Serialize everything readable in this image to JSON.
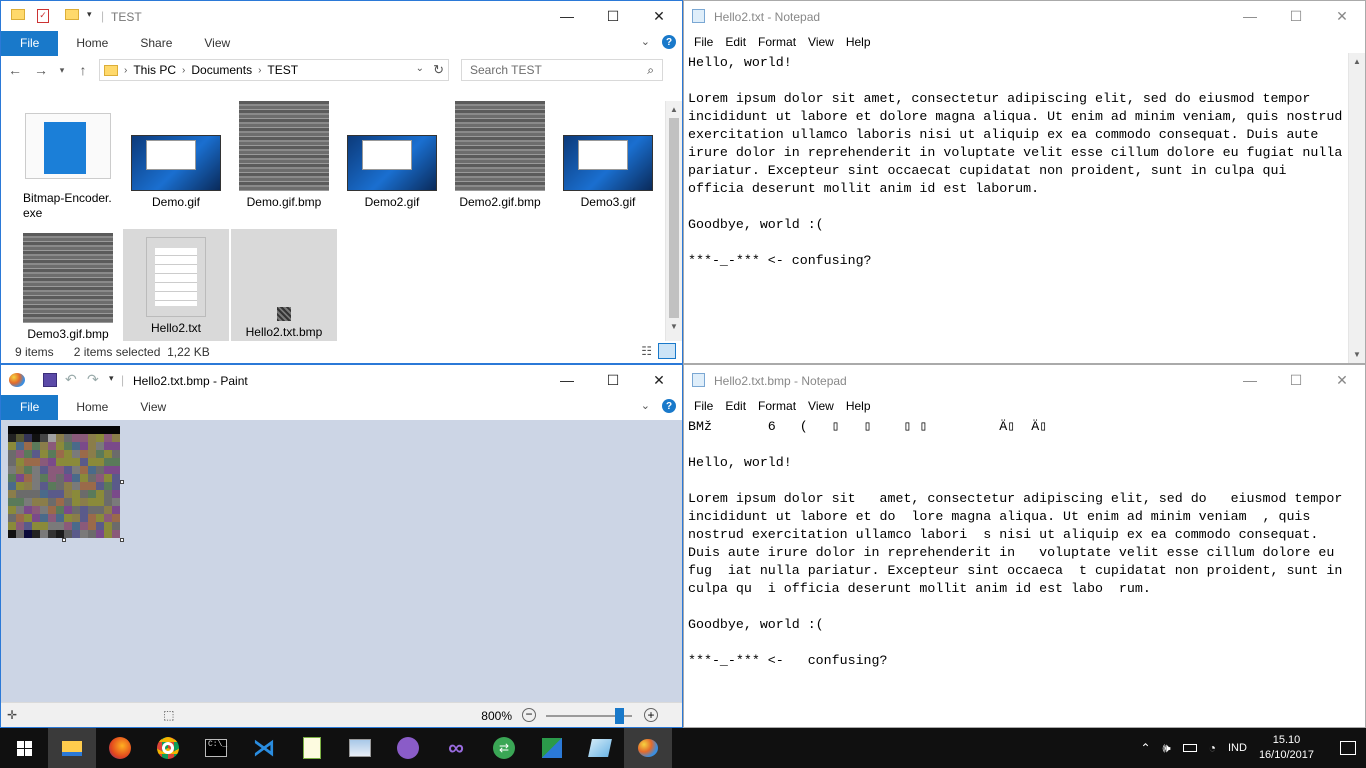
{
  "explorer": {
    "title": "TEST",
    "tabs": [
      "File",
      "Home",
      "Share",
      "View"
    ],
    "path": [
      "This PC",
      "Documents",
      "TEST"
    ],
    "search_placeholder": "Search TEST",
    "items": [
      {
        "name": "Bitmap-Encoder.\nexe",
        "kind": "exe",
        "selected": false
      },
      {
        "name": "Demo.gif",
        "kind": "desktop",
        "selected": false
      },
      {
        "name": "Demo.gif.bmp",
        "kind": "wood",
        "selected": false
      },
      {
        "name": "Demo2.gif",
        "kind": "desktop",
        "selected": false
      },
      {
        "name": "Demo2.gif.bmp",
        "kind": "wood",
        "selected": false
      },
      {
        "name": "Demo3.gif",
        "kind": "desktop",
        "selected": false
      },
      {
        "name": "Demo3.gif.bmp",
        "kind": "wood",
        "selected": false
      },
      {
        "name": "Hello2.txt",
        "kind": "txt",
        "selected": true
      },
      {
        "name": "Hello2.txt.bmp",
        "kind": "bmp",
        "selected": true
      }
    ],
    "status": {
      "count": "9 items",
      "selection": "2 items selected  1,22 KB"
    }
  },
  "notepad_top": {
    "title": "Hello2.txt - Notepad",
    "menu": [
      "File",
      "Edit",
      "Format",
      "View",
      "Help"
    ],
    "content": "Hello, world!\n\nLorem ipsum dolor sit amet, consectetur adipiscing elit, sed do eiusmod tempor\nincididunt ut labore et dolore magna aliqua. Ut enim ad minim veniam, quis nostrud\nexercitation ullamco laboris nisi ut aliquip ex ea commodo consequat. Duis aute\nirure dolor in reprehenderit in voluptate velit esse cillum dolore eu fugiat nulla\npariatur. Excepteur sint occaecat cupidatat non proident, sunt in culpa qui\nofficia deserunt mollit anim id est laborum.\n\nGoodbye, world :(\n\n***-_-*** <- confusing?"
  },
  "notepad_bottom": {
    "title": "Hello2.txt.bmp - Notepad",
    "menu": [
      "File",
      "Edit",
      "Format",
      "View",
      "Help"
    ],
    "content": "BMž       6   (   ▯   ▯    ▯ ▯         Ä▯  Ä▯\n\nHello, world!\n\nLorem ipsum dolor sit   amet, consectetur adipiscing elit, sed do   eiusmod tempor\nincididunt ut labore et do  lore magna aliqua. Ut enim ad minim veniam  , quis\nnostrud exercitation ullamco labori  s nisi ut aliquip ex ea commodo consequat.\nDuis aute irure dolor in reprehenderit in   voluptate velit esse cillum dolore eu\nfug  iat nulla pariatur. Excepteur sint occaeca  t cupidatat non proident, sunt in\nculpa qu  i officia deserunt mollit anim id est labo  rum.\n\nGoodbye, world :(\n\n***-_-*** <-   confusing?"
  },
  "paint": {
    "title": "Hello2.txt.bmp - Paint",
    "tabs": [
      "File",
      "Home",
      "View"
    ],
    "zoom": "800%",
    "zoom_fraction": 0.85
  },
  "taskbar": {
    "apps": [
      "file-explorer-icon",
      "firefox-icon",
      "chrome-icon",
      "command-prompt-icon",
      "visual-studio-code-icon",
      "notepad-plus-icon",
      "photo-viewer-icon",
      "github-desktop-icon",
      "visual-studio-icon",
      "remote-desktop-icon",
      "network-icon",
      "paint-3d-icon",
      "paint-icon"
    ],
    "lang": "IND",
    "time": "15.10",
    "date": "16/10/2017"
  },
  "colors": {
    "accent": "#1979ca",
    "taskbar": "#101010"
  }
}
